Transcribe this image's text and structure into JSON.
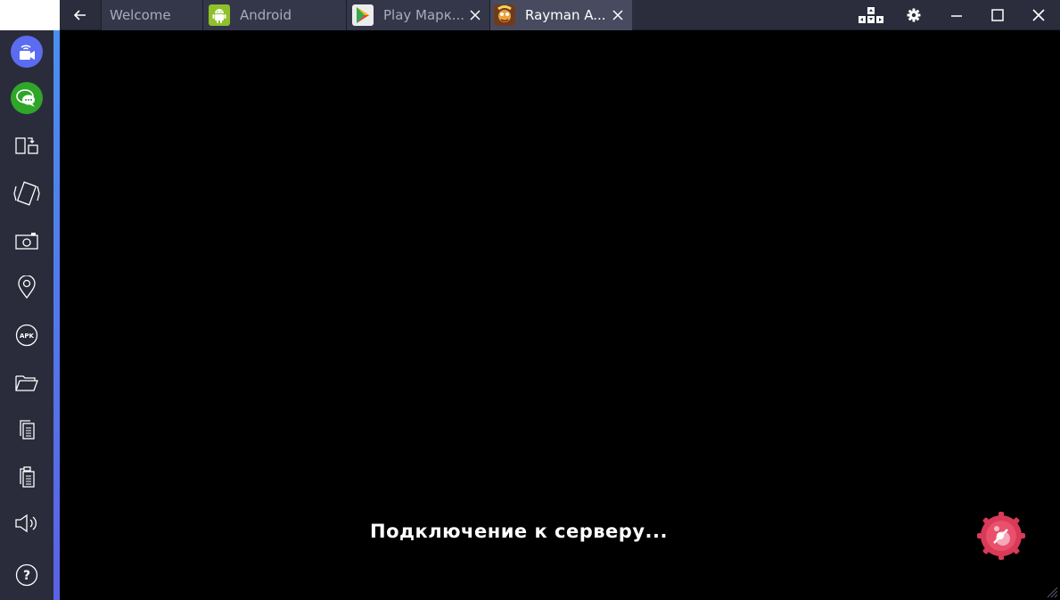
{
  "window": {
    "tabs": [
      {
        "label": "Welcome",
        "icon": "none",
        "active": false,
        "closable": false
      },
      {
        "label": "Android",
        "icon": "android-icon",
        "active": false,
        "closable": false
      },
      {
        "label": "Play Марк...",
        "icon": "play-store-icon",
        "active": false,
        "closable": true
      },
      {
        "label": "Rayman A...",
        "icon": "rayman-app-icon",
        "active": true,
        "closable": true
      }
    ],
    "controls": [
      "keyboard-mapping-icon",
      "settings-gear-icon",
      "minimize-icon",
      "maximize-icon",
      "close-icon"
    ]
  },
  "sidebar": {
    "items": [
      {
        "name": "video-call-icon",
        "color": "#5b6cf0"
      },
      {
        "name": "chat-bubble-icon",
        "color": "#2fa52a"
      },
      {
        "name": "rotate-screen-icon"
      },
      {
        "name": "shake-icon"
      },
      {
        "name": "camera-screenshot-icon"
      },
      {
        "name": "location-pin-icon"
      },
      {
        "name": "apk-install-icon",
        "label": "APK"
      },
      {
        "name": "folder-icon"
      },
      {
        "name": "copy-icon"
      },
      {
        "name": "paste-icon"
      },
      {
        "name": "volume-icon"
      },
      {
        "name": "help-icon",
        "label": "?"
      }
    ],
    "accent_color": "#4a8ff0"
  },
  "game": {
    "status_text": "Подключение к серверу...",
    "background": "#000000"
  }
}
